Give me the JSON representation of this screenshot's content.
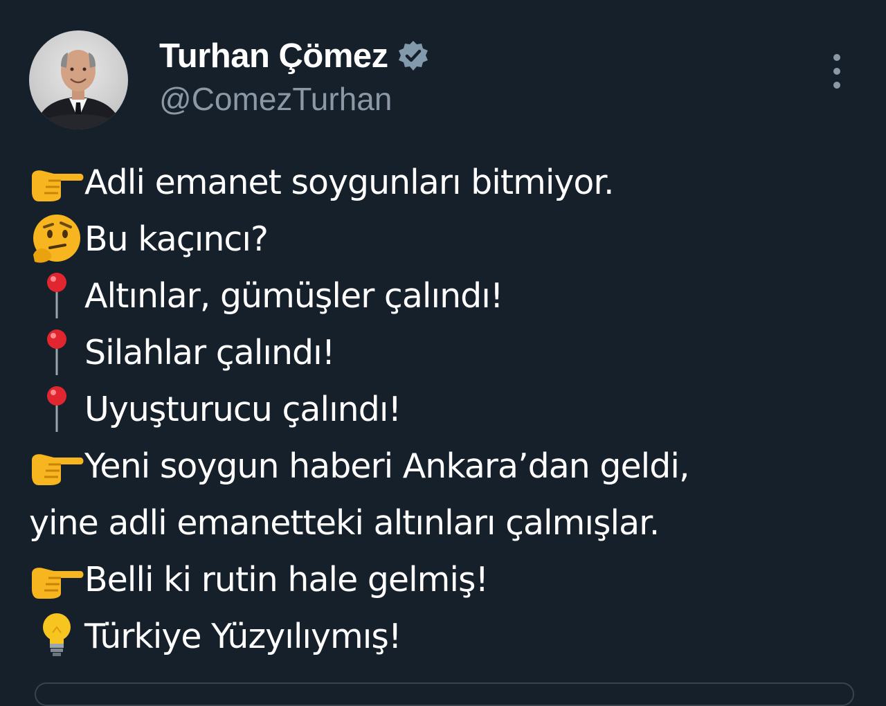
{
  "tweet": {
    "author": {
      "display_name": "Turhan Çömez",
      "handle": "@ComezTurhan",
      "verified": true
    },
    "lines": [
      {
        "icon": "backhand-index-pointing-right-icon",
        "text": "Adli emanet soygunları bitmiyor."
      },
      {
        "icon": "thinking-face-icon",
        "text": "Bu kaçıncı?"
      },
      {
        "icon": "round-pushpin-icon",
        "text": "Altınlar, gümüşler çalındı!"
      },
      {
        "icon": "round-pushpin-icon",
        "text": "Silahlar çalındı!"
      },
      {
        "icon": "round-pushpin-icon",
        "text": "Uyuşturucu çalındı!"
      },
      {
        "icon": "backhand-index-pointing-right-icon",
        "text": "Yeni soygun haberi Ankara’dan geldi,"
      },
      {
        "icon": "",
        "text": "yine adli emanetteki altınları çalmışlar."
      },
      {
        "icon": "backhand-index-pointing-right-icon",
        "text": "Belli ki rutin hale gelmiş!"
      },
      {
        "icon": "light-bulb-icon",
        "text": "Türkiye Yüzyılıymış!"
      }
    ]
  },
  "colors": {
    "background": "#15202b",
    "text": "#ffffff",
    "secondary_text": "#8b98a5",
    "verified_badge": "#829aab"
  }
}
